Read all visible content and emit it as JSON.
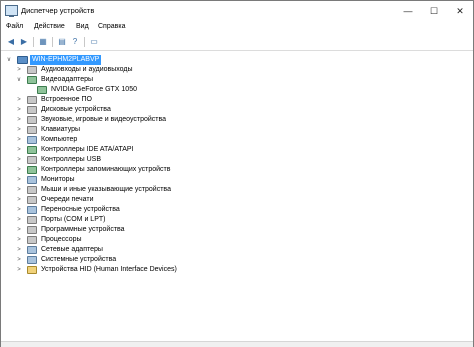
{
  "window": {
    "title": "Диспетчер устройств"
  },
  "titlebar": {
    "minimize": "—",
    "maximize": "☐",
    "close": "✕"
  },
  "menu": [
    "Файл",
    "Действие",
    "Вид",
    "Справка"
  ],
  "toolbar": {
    "back": "◀",
    "forward": "▶",
    "grid": "▦",
    "props": "▤",
    "help": "?",
    "scan": "▣",
    "monitor": "▭"
  },
  "tree": {
    "root": "WIN-EPHM2PLABVP",
    "expanded_mark": "∨",
    "collapsed_mark": ">",
    "items": [
      {
        "label": "Аудиовходы и аудиовыходы",
        "icon": "audio-icon"
      },
      {
        "label": "Видеоадаптеры",
        "icon": "display-adapter-icon",
        "expanded": true,
        "children": [
          "NVIDIA GeForce GTX 1050"
        ]
      },
      {
        "label": "Встроенное ПО",
        "icon": "firmware-icon"
      },
      {
        "label": "Дисковые устройства",
        "icon": "disk-icon"
      },
      {
        "label": "Звуковые, игровые и видеоустройства",
        "icon": "sound-icon"
      },
      {
        "label": "Клавиатуры",
        "icon": "keyboard-icon"
      },
      {
        "label": "Компьютер",
        "icon": "computer-icon"
      },
      {
        "label": "Контроллеры IDE ATA/ATAPI",
        "icon": "ide-icon"
      },
      {
        "label": "Контроллеры USB",
        "icon": "usb-icon"
      },
      {
        "label": "Контроллеры запоминающих устройств",
        "icon": "storage-icon"
      },
      {
        "label": "Мониторы",
        "icon": "monitor-icon"
      },
      {
        "label": "Мыши и иные указывающие устройства",
        "icon": "mouse-icon"
      },
      {
        "label": "Очереди печати",
        "icon": "printer-icon"
      },
      {
        "label": "Переносные устройства",
        "icon": "portable-icon"
      },
      {
        "label": "Порты (COM и LPT)",
        "icon": "port-icon"
      },
      {
        "label": "Программные устройства",
        "icon": "software-icon"
      },
      {
        "label": "Процессоры",
        "icon": "cpu-icon"
      },
      {
        "label": "Сетевые адаптеры",
        "icon": "network-icon"
      },
      {
        "label": "Системные устройства",
        "icon": "system-icon"
      },
      {
        "label": "Устройства HID (Human Interface Devices)",
        "icon": "hid-icon"
      }
    ]
  }
}
